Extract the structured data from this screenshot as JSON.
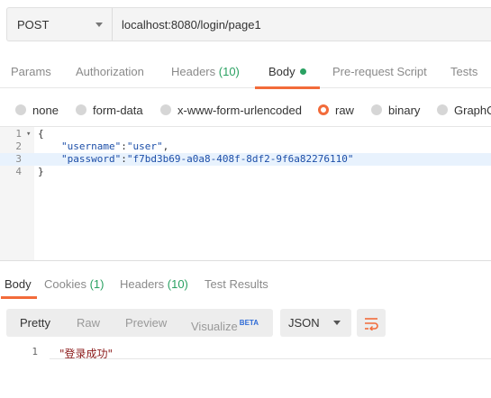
{
  "request": {
    "method": "POST",
    "url": "localhost:8080/login/page1"
  },
  "request_tabs": [
    {
      "label": "Params"
    },
    {
      "label": "Authorization"
    },
    {
      "label": "Headers",
      "count": "(10)"
    },
    {
      "label": "Body"
    },
    {
      "label": "Pre-request Script"
    },
    {
      "label": "Tests"
    }
  ],
  "body_types": [
    "none",
    "form-data",
    "x-www-form-urlencoded",
    "raw",
    "binary",
    "GraphQ"
  ],
  "selected_body_type": "raw",
  "editor": {
    "line_numbers": [
      "1",
      "2",
      "3",
      "4"
    ],
    "l1": "{",
    "l2_key": "\"username\"",
    "l2_colon": ":",
    "l2_val": "\"user\"",
    "l2_comma": ",",
    "l3_key": "\"password\"",
    "l3_colon": ":",
    "l3_val": "\"f7bd3b69-a0a8-408f-8df2-9f6a82276110\"",
    "l4": "}"
  },
  "response_tabs": [
    {
      "label": "Body"
    },
    {
      "label": "Cookies",
      "count": "(1)"
    },
    {
      "label": "Headers",
      "count": "(10)"
    },
    {
      "label": "Test Results"
    }
  ],
  "view_modes": [
    "Pretty",
    "Raw",
    "Preview",
    "Visualize"
  ],
  "beta_label": "BETA",
  "format": "JSON",
  "response_body": {
    "line_number": "1",
    "text": "\"登录成功\""
  },
  "colors": {
    "accent": "#f26b3a",
    "count_green": "#2aa162",
    "json_key": "#1c4ea8",
    "response_string": "#8b1a1a"
  }
}
